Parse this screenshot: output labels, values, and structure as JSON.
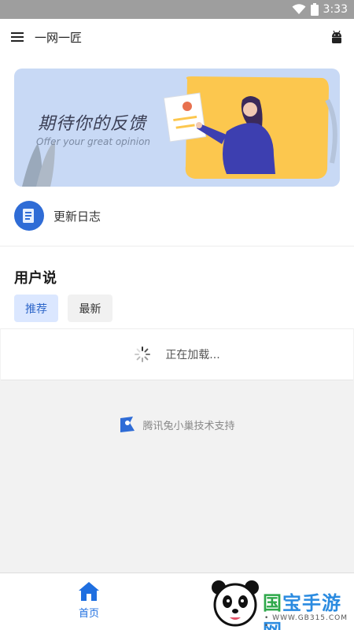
{
  "status": {
    "time": "3:33"
  },
  "appbar": {
    "title": "一网一匠"
  },
  "banner": {
    "headline": "期待你的反馈",
    "subline": "Offer your great opinion"
  },
  "changelog": {
    "label": "更新日志"
  },
  "section": {
    "heading": "用户说",
    "tabs": [
      "推荐",
      "最新"
    ],
    "active_tab": "推荐"
  },
  "loading": {
    "text": "正在加载..."
  },
  "support": {
    "text": "腾讯兔小巢技术支持"
  },
  "bottom_nav": {
    "items": [
      {
        "label": "首页",
        "icon": "home-icon"
      }
    ]
  },
  "watermark": {
    "brand": "国宝手游网",
    "brand_green": "国",
    "brand_blue": "宝手游网",
    "url": "• WWW.GB315.COM •"
  },
  "colors": {
    "accent": "#1f6fe0",
    "chip_active_bg": "#dbe7ff",
    "statusbar": "#9e9e9e"
  }
}
